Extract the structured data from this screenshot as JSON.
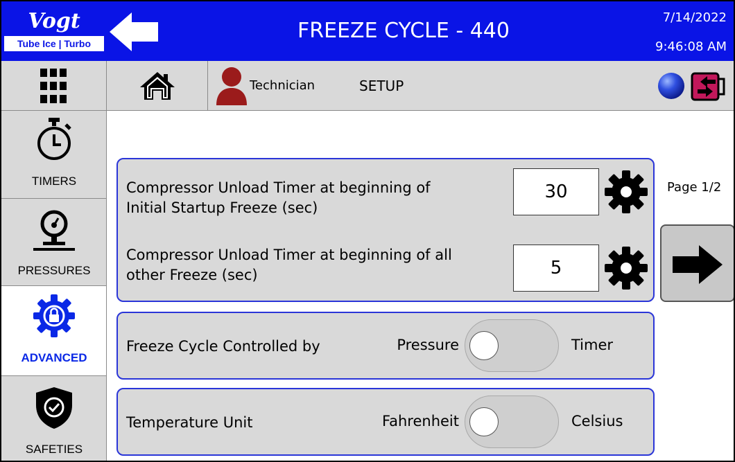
{
  "header": {
    "logo_top": "Vogt",
    "logo_bottom": "Tube Ice | Turbo",
    "title": "FREEZE CYCLE - 440",
    "date": "7/14/2022",
    "time": "9:46:08 AM"
  },
  "navbar": {
    "user_role": "Technician",
    "section": "SETUP"
  },
  "sidebar": {
    "items": [
      {
        "label": "TIMERS",
        "icon": "stopwatch-icon",
        "active": false
      },
      {
        "label": "PRESSURES",
        "icon": "pressure-gauge-icon",
        "active": false
      },
      {
        "label": "ADVANCED",
        "icon": "lock-gear-icon",
        "active": true
      },
      {
        "label": "SAFETIES",
        "icon": "shield-check-icon",
        "active": false
      }
    ]
  },
  "timers_panel": {
    "rows": [
      {
        "label_line1": "Compressor Unload Timer at beginning of",
        "label_line2": "Initial Startup Freeze (sec)",
        "value": "30"
      },
      {
        "label_line1": "Compressor Unload Timer at beginning of all",
        "label_line2": "other Freeze (sec)",
        "value": "5"
      }
    ]
  },
  "freeze_control": {
    "label": "Freeze Cycle Controlled by",
    "option_left": "Pressure",
    "option_right": "Timer",
    "selected": "Pressure"
  },
  "temperature_unit": {
    "label": "Temperature Unit",
    "option_left": "Fahrenheit",
    "option_right": "Celsius",
    "selected": "Fahrenheit"
  },
  "pagination": {
    "label": "Page 1/2"
  },
  "colors": {
    "header_blue": "#0a14e6",
    "panel_border": "#2a35d8",
    "active_sidebar": "#0a28e6",
    "user_icon": "#9b1b1b",
    "logout_icon": "#c2185b"
  }
}
